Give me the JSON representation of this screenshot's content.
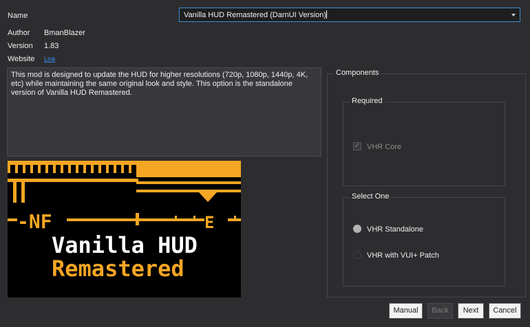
{
  "info": {
    "name_label": "Name",
    "author_label": "Author",
    "author_value": "BmanBlazer",
    "version_label": "Version",
    "version_value": "1.83",
    "website_label": "Website",
    "website_link": "Link"
  },
  "name_select": {
    "value": "Vanilla HUD Remastered (DarnUI Version)"
  },
  "description": "This mod is designed to update the HUD for higher resolutions (720p, 1080p, 1440p, 4K, etc) while maintaining the same original look and style. This option is the standalone version of Vanilla HUD Remastered.",
  "banner": {
    "title_line1": "Vanilla HUD",
    "title_line2": "Remastered",
    "compass_left": "-NF",
    "compass_mark": "E"
  },
  "components": {
    "title": "Components",
    "required": {
      "title": "Required",
      "items": [
        {
          "label": "VHR Core",
          "checked": true,
          "disabled": true
        }
      ]
    },
    "select_one": {
      "title": "Select One",
      "options": [
        {
          "label": "VHR Standalone",
          "selected": true
        },
        {
          "label": "VHR with VUI+ Patch",
          "selected": false
        }
      ]
    }
  },
  "buttons": {
    "manual": "Manual",
    "back": "Back",
    "next": "Next",
    "cancel": "Cancel"
  },
  "colors": {
    "background": "#2d2d30",
    "accent_focus": "#3c8fd6",
    "link": "#3a8ef0",
    "banner_orange": "#f5a623"
  }
}
